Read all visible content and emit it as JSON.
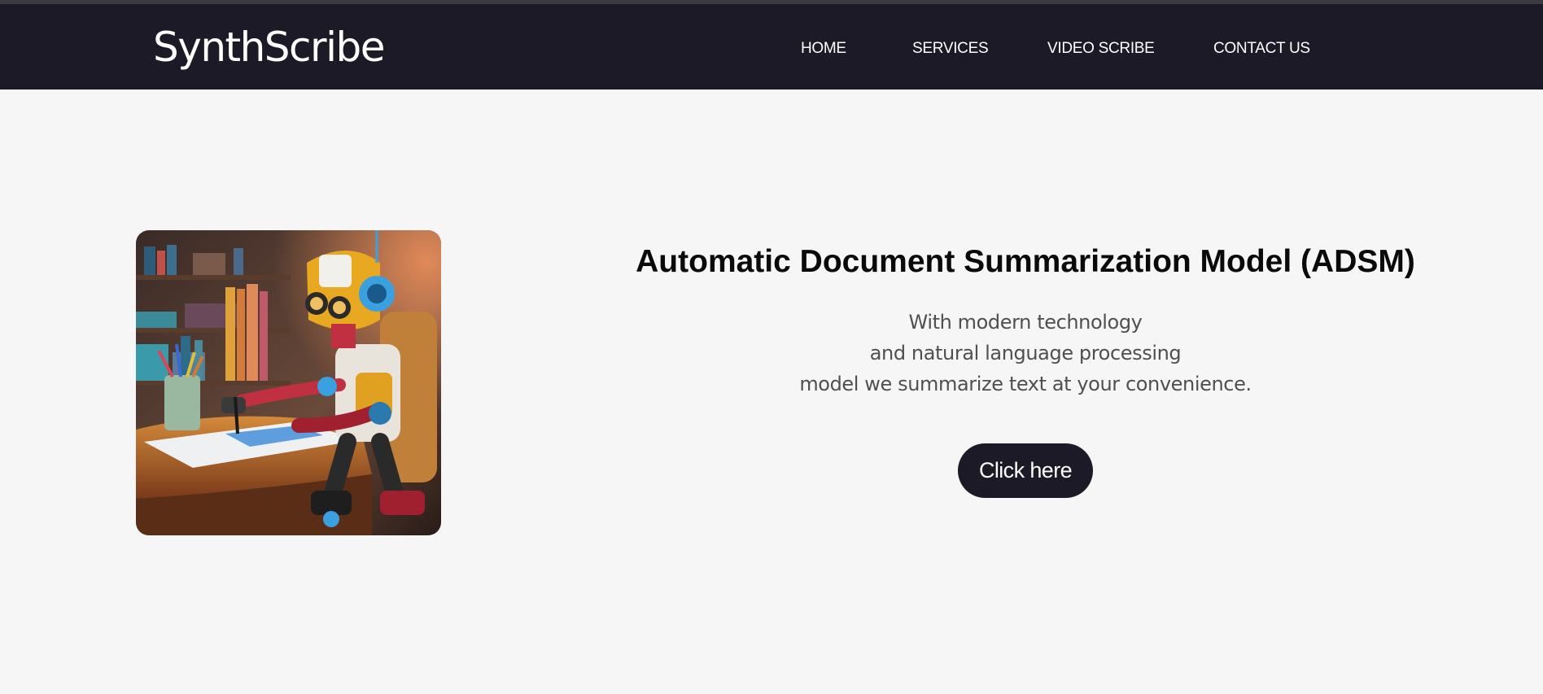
{
  "brand": {
    "logo_text": "SynthScribe"
  },
  "nav": {
    "items": [
      {
        "label": "HOME"
      },
      {
        "label": "SERVICES"
      },
      {
        "label": "VIDEO SCRIBE"
      },
      {
        "label": "CONTACT US"
      }
    ]
  },
  "hero": {
    "image_subject": "robot writing at desk",
    "title": "Automatic Document Summarization Model (ADSM)",
    "description_lines": [
      "With modern technology",
      "and natural language processing",
      "model we summarize text at your convenience."
    ],
    "cta_label": "Click here"
  },
  "colors": {
    "navbar_bg": "#1b1a26",
    "page_bg": "#f6f6f6",
    "button_bg": "#1b1a26",
    "text_white": "#ffffff"
  }
}
